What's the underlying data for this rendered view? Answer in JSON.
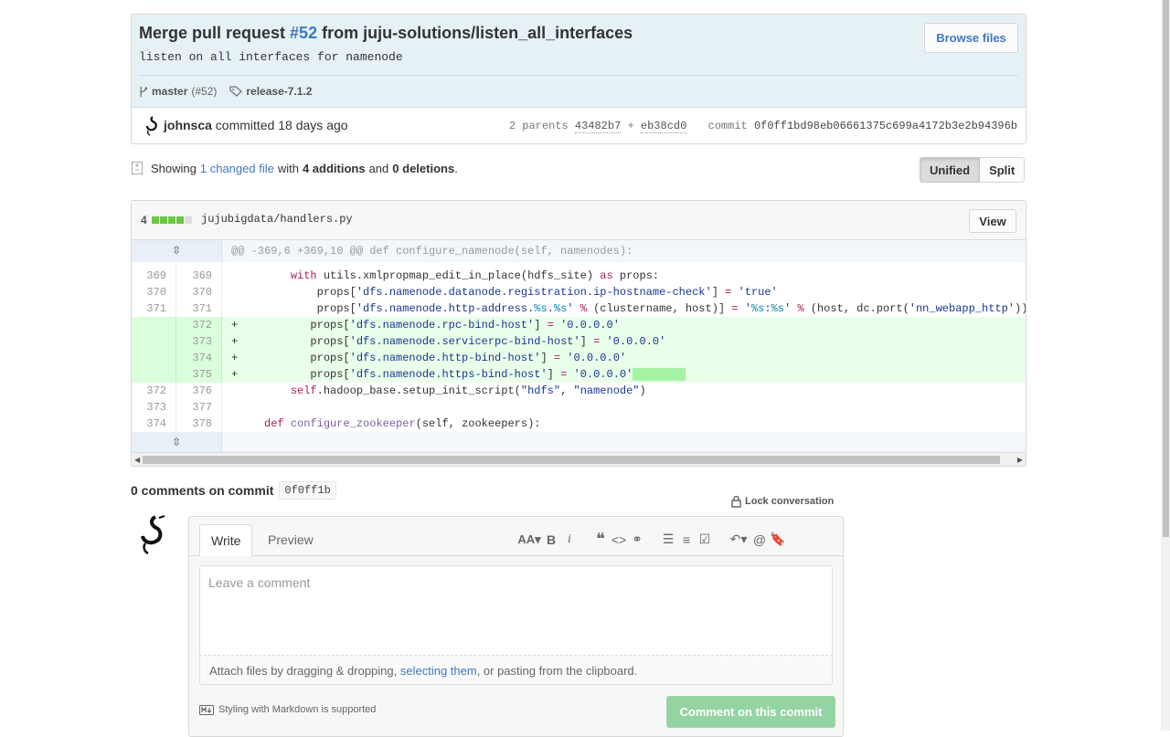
{
  "commit": {
    "title_prefix": "Merge pull request ",
    "pr_link": "#52",
    "title_suffix": " from juju-solutions/listen_all_interfaces",
    "description": "listen on all interfaces for namenode",
    "branch": "master",
    "branch_pr": "(#52)",
    "tag": "release-7.1.2",
    "browse_files": "Browse files",
    "author": "johnsca",
    "committed": "committed",
    "time_ago": "18 days ago",
    "parents_label": "2 parents",
    "parent1": "43482b7",
    "plus": "+",
    "parent2": "eb38cd0",
    "commit_label": "commit",
    "sha": "0f0ff1bd98eb06661375c699a4172b3e2b94396b"
  },
  "toc": {
    "showing": "Showing",
    "changed_files": "1 changed file",
    "with": "with",
    "additions": "4 additions",
    "and": "and",
    "deletions": "0 deletions",
    "period": ".",
    "unified": "Unified",
    "split": "Split"
  },
  "file": {
    "diffstat_count": "4",
    "path": "jujubigdata/handlers.py",
    "view": "View",
    "hunk_header": "@@ -369,6 +369,10 @@ def configure_namenode(self, namenodes):",
    "lines": [
      {
        "old": "369",
        "new": "369",
        "marker": " "
      },
      {
        "old": "370",
        "new": "370",
        "marker": " "
      },
      {
        "old": "371",
        "new": "371",
        "marker": " "
      },
      {
        "old": "",
        "new": "372",
        "marker": "+"
      },
      {
        "old": "",
        "new": "373",
        "marker": "+"
      },
      {
        "old": "",
        "new": "374",
        "marker": "+"
      },
      {
        "old": "",
        "new": "375",
        "marker": "+"
      },
      {
        "old": "372",
        "new": "376",
        "marker": " "
      },
      {
        "old": "373",
        "new": "377",
        "marker": " "
      },
      {
        "old": "374",
        "new": "378",
        "marker": " "
      }
    ]
  },
  "comments": {
    "count_title": "0 comments on commit",
    "short_sha": "0f0ff1b",
    "lock": "Lock conversation",
    "tab_write": "Write",
    "tab_preview": "Preview",
    "placeholder": "Leave a comment",
    "attach_prefix": "Attach files by dragging & dropping, ",
    "attach_link": "selecting them",
    "attach_suffix": ", or pasting from the clipboard.",
    "markdown_note": "Styling with Markdown is supported",
    "submit": "Comment on this commit"
  },
  "colors": {
    "accent": "#4078c0",
    "added_bg": "#eaffea",
    "added_gutter": "#dbffdb",
    "hunk_bg": "#f3f7fb",
    "submit_bg": "#94d3a2",
    "header_bg": "#e6f1f6"
  },
  "icons": [
    "git-branch-icon",
    "tag-icon",
    "file-diff-icon",
    "expand-icon",
    "lock-icon",
    "markdown-icon"
  ]
}
